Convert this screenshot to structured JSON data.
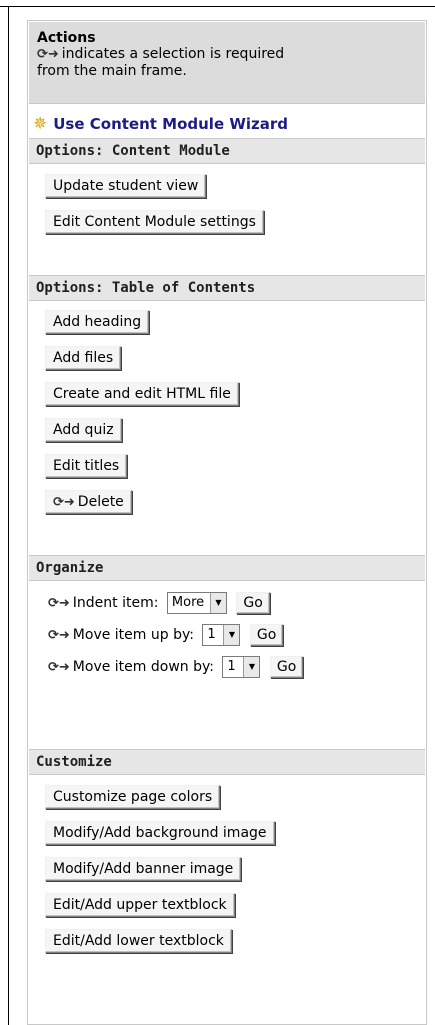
{
  "actions": {
    "title": "Actions",
    "desc_line1": "indicates a selection is required",
    "desc_line2": "from the main frame."
  },
  "wizard": {
    "label": "Use Content Module Wizard"
  },
  "sections": {
    "content_module": "Options: Content Module",
    "toc": "Options: Table of Contents",
    "organize": "Organize",
    "customize": "Customize"
  },
  "content_module_buttons": {
    "update": "Update student view",
    "edit_settings": "Edit Content Module settings"
  },
  "toc_buttons": {
    "add_heading": "Add heading",
    "add_files": "Add files",
    "create_html": "Create and edit HTML file",
    "add_quiz": "Add quiz",
    "edit_titles": "Edit titles",
    "delete": "Delete"
  },
  "organize": {
    "indent_label": "Indent item:",
    "indent_value": "More",
    "move_up_label": "Move item up by:",
    "move_up_value": "1",
    "move_down_label": "Move item down by:",
    "move_down_value": "1",
    "go": "Go"
  },
  "customize_buttons": {
    "page_colors": "Customize page colors",
    "background": "Modify/Add background image",
    "banner": "Modify/Add banner image",
    "upper": "Edit/Add upper textblock",
    "lower": "Edit/Add lower textblock"
  },
  "icons": {
    "selection_required": "arrow-selection-icon",
    "wizard": "wizard-star-icon"
  }
}
